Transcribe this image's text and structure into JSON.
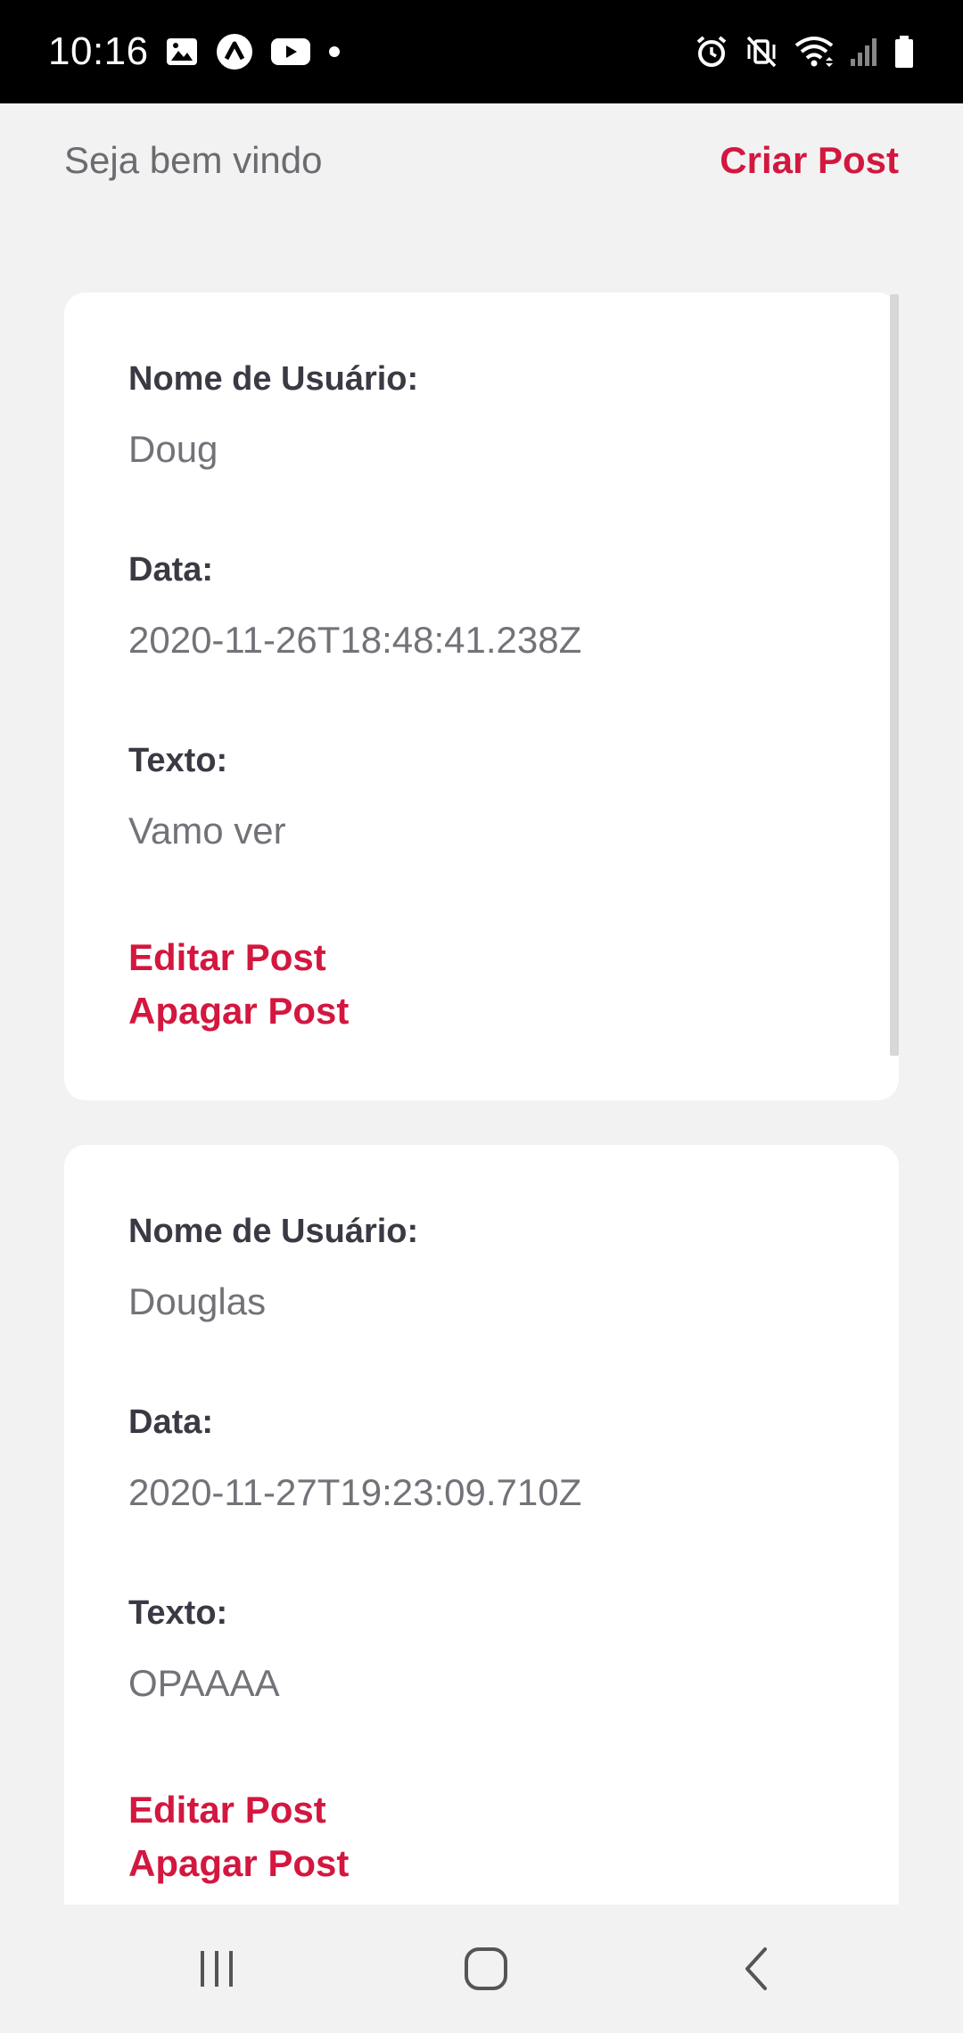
{
  "status_bar": {
    "time": "10:16",
    "left_icons": [
      "image-icon",
      "app-launcher-icon",
      "youtube-icon",
      "notification-dot-icon"
    ],
    "right_icons": [
      "alarm-icon",
      "vibrate-off-icon",
      "wifi-icon",
      "signal-icon",
      "battery-icon"
    ]
  },
  "header": {
    "welcome": "Seja bem vindo",
    "create_post": "Criar Post"
  },
  "posts": [
    {
      "user_label": "Nome de Usuário:",
      "user": "Doug",
      "date_label": "Data:",
      "date": "2020-11-26T18:48:41.238Z",
      "text_label": "Texto:",
      "text": "Vamo ver",
      "edit": "Editar Post",
      "delete": "Apagar Post"
    },
    {
      "user_label": "Nome de Usuário:",
      "user": "Douglas",
      "date_label": "Data:",
      "date": "2020-11-27T19:23:09.710Z",
      "text_label": "Texto:",
      "text": "OPAAAA",
      "edit": "Editar Post",
      "delete": "Apagar Post"
    }
  ],
  "nav": {
    "icons": [
      "recent-apps-icon",
      "home-icon",
      "back-icon"
    ]
  },
  "colors": {
    "accent": "#d3173f",
    "label": "#3a3a44",
    "value": "#727279",
    "background": "#f2f2f2",
    "card": "#ffffff"
  }
}
